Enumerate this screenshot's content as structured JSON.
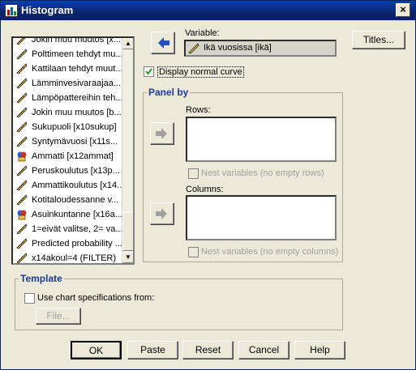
{
  "window": {
    "title": "Histogram",
    "close_glyph": "×"
  },
  "variables_list": {
    "items": [
      {
        "label": "Jokin muu muutos [x...",
        "icon": "ruler-icon"
      },
      {
        "label": "Polttimeen tehdyt mu...",
        "icon": "ruler-icon"
      },
      {
        "label": "Kattilaan tehdyt muut...",
        "icon": "ruler-icon"
      },
      {
        "label": "Lämminvesivaraajaa...",
        "icon": "ruler-icon"
      },
      {
        "label": "Lämpöpattereihin teh...",
        "icon": "ruler-icon"
      },
      {
        "label": "Jokin muu muutos [b...",
        "icon": "ruler-icon"
      },
      {
        "label": "Sukupuoli [x10sukup]",
        "icon": "ruler-icon"
      },
      {
        "label": "Syntymävuosi [x11s...",
        "icon": "ruler-icon"
      },
      {
        "label": "Ammatti [x12ammat]",
        "icon": "nominal-icon"
      },
      {
        "label": "Peruskoulutus [x13p...",
        "icon": "ruler-icon"
      },
      {
        "label": "Ammattikoulutus [x14...",
        "icon": "ruler-icon"
      },
      {
        "label": "Kotitaloudessanne v...",
        "icon": "ruler-icon"
      },
      {
        "label": "Asuinkuntanne [x16a...",
        "icon": "nominal-icon"
      },
      {
        "label": "1=eivät valitse, 2= va...",
        "icon": "ruler-icon"
      },
      {
        "label": "Predicted probability ...",
        "icon": "ruler-icon"
      },
      {
        "label": "x14akoul=4 (FILTER)",
        "icon": "ruler-icon"
      }
    ]
  },
  "variable": {
    "label": "Variable:",
    "value": "Ikä vuosissa [ikä]"
  },
  "titles_button": "Titles...",
  "normal_curve": {
    "label": "Display normal curve",
    "checked": true
  },
  "panel_by": {
    "legend": "Panel by",
    "rows_label": "Rows:",
    "rows_nest": "Nest variables (no empty rows)",
    "columns_label": "Columns:",
    "columns_nest": "Nest variables (no empty columns)"
  },
  "template": {
    "legend": "Template",
    "checkbox_label": "Use chart specifications from:",
    "file_button": "File..."
  },
  "buttons": {
    "ok": "OK",
    "paste": "Paste",
    "reset": "Reset",
    "cancel": "Cancel",
    "help": "Help"
  },
  "colors": {
    "accent": "#0a246a",
    "legend": "#1d3c8f",
    "arrow_active": "#2050c8",
    "arrow_disabled": "#a0a0a0"
  }
}
